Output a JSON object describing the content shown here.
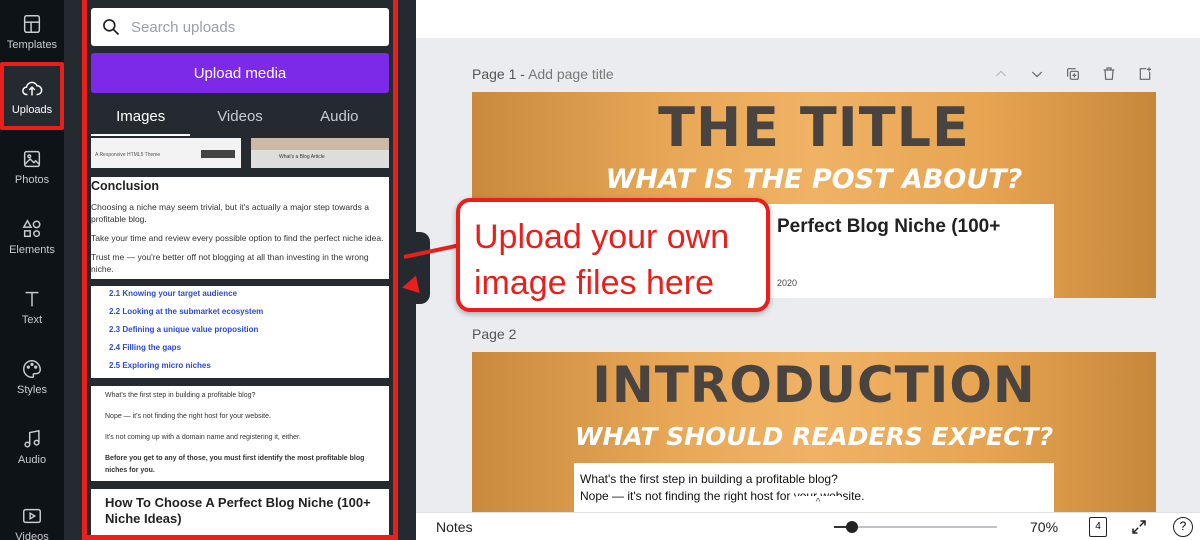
{
  "sidebar": {
    "items": [
      {
        "label": "Templates",
        "icon": "templates-icon"
      },
      {
        "label": "Uploads",
        "icon": "cloud-upload-icon",
        "active": true
      },
      {
        "label": "Photos",
        "icon": "image-icon"
      },
      {
        "label": "Elements",
        "icon": "shapes-icon"
      },
      {
        "label": "Text",
        "icon": "text-icon"
      },
      {
        "label": "Styles",
        "icon": "palette-icon"
      },
      {
        "label": "Audio",
        "icon": "music-note-icon"
      },
      {
        "label": "Videos",
        "icon": "video-icon"
      }
    ]
  },
  "panel": {
    "search_placeholder": "Search uploads",
    "upload_button": "Upload media",
    "tabs": [
      {
        "label": "Images",
        "active": true
      },
      {
        "label": "Videos"
      },
      {
        "label": "Audio"
      }
    ],
    "thumb_top_left_caption": "A Responsive HTML5 Theme",
    "thumb_top_right_caption": "What's a Blog Article",
    "card1": {
      "heading": "Conclusion",
      "paragraphs": [
        "Choosing a niche may seem trivial, but it's actually a major step towards a profitable blog.",
        "Take your time and review every possible option to find the perfect niche idea.",
        "Trust me — you're better off not blogging at all than investing in the wrong niche."
      ]
    },
    "card2": {
      "links": [
        "2.1 Knowing your target audience",
        "2.2 Looking at the submarket ecosystem",
        "2.3 Defining a unique value proposition",
        "2.4 Filling the gaps",
        "2.5 Exploring micro niches"
      ]
    },
    "card3": {
      "paragraphs": [
        "What's the first step in building a profitable blog?",
        "Nope — it's not finding the right host for your website.",
        "It's not coming up with a domain name and registering it, either.",
        "Before you get to any of those, you must first identify the most profitable blog niches for you."
      ]
    },
    "card4": {
      "heading": "How To Choose A Perfect Blog Niche (100+ Niche Ideas)"
    }
  },
  "canvas": {
    "page1": {
      "label": "Page 1 -",
      "title_placeholder": "Add page title",
      "big_text": "THE TITLE",
      "sub_text": "WHAT IS THE POST ABOUT?",
      "box_text": "Perfect Blog Niche (100+",
      "box_date": "2020"
    },
    "page2": {
      "label": "Page 2",
      "big_text": "INTRODUCTION",
      "sub_text": "WHAT SHOULD READERS EXPECT?",
      "box_line1": "What's the first step in building a profitable blog?",
      "box_line2": "Nope — it's not finding the right host for your website."
    }
  },
  "callout": {
    "line1": "Upload your own",
    "line2": "image files here"
  },
  "bottombar": {
    "notes": "Notes",
    "zoom": "70%",
    "zoom_level": 0.7,
    "page_count": "4",
    "help": "?",
    "scroll_chevron": "^"
  },
  "colors": {
    "accent_purple": "#7d2ae8",
    "highlight_red": "#e8201c",
    "rail_bg": "#0e1318",
    "panel_bg": "#252a31"
  }
}
